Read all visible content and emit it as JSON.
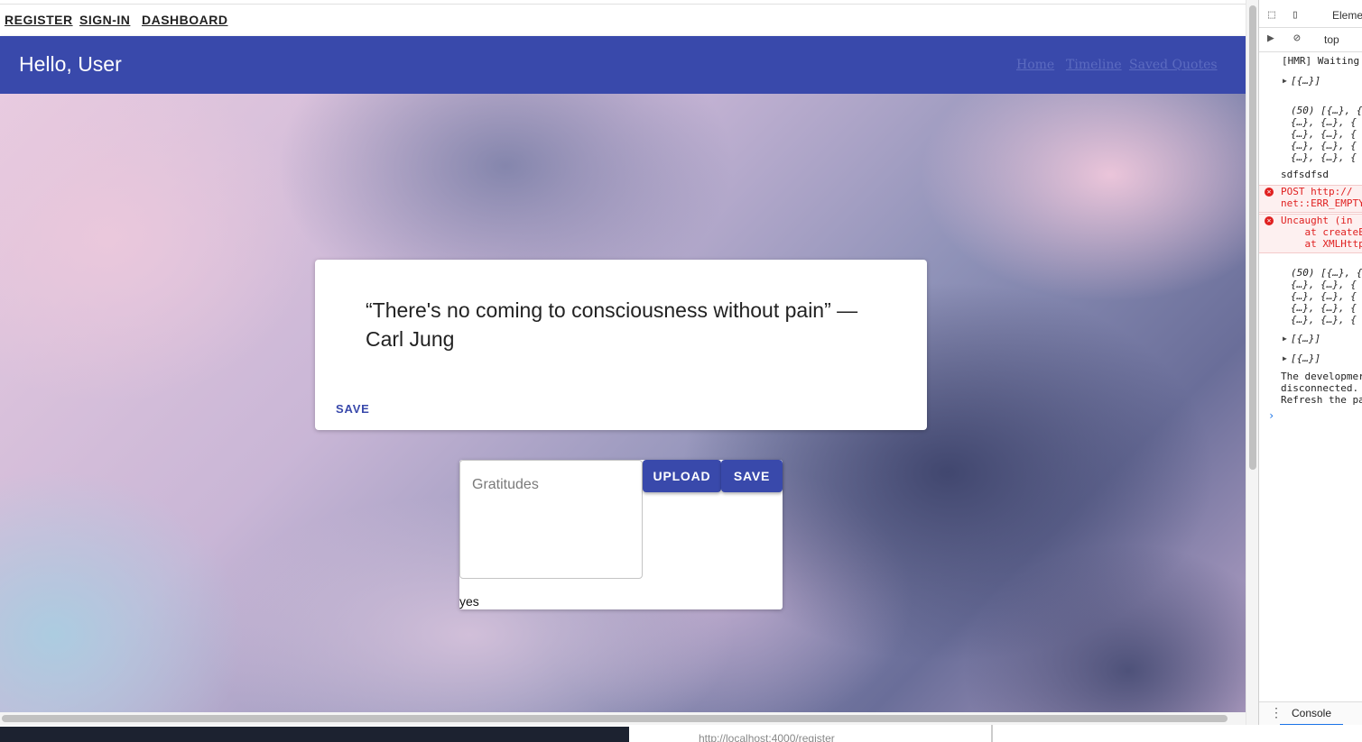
{
  "topnav": {
    "register": "REGISTER",
    "signin": "SIGN-IN",
    "dashboard": "DASHBOARD"
  },
  "appbar": {
    "title": "Hello, User",
    "links": [
      "Home",
      "Timeline",
      "Saved Quotes"
    ]
  },
  "quote_card": {
    "quote": "“There's no coming to consciousness without pain” — Carl Jung",
    "save_label": "SAVE"
  },
  "gratitude": {
    "placeholder": "Gratitudes",
    "upload_label": "UPLOAD",
    "save_label": "SAVE",
    "entry": "yes"
  },
  "bottom": {
    "url": "http://localhost:4000/register"
  },
  "devtools": {
    "tab_elements": "Eleme",
    "context": "top",
    "logs": {
      "l1": "[HMR] Waiting",
      "l2": "[{…}]",
      "l3": "(50) [{…}, {\n{…}, {…}, {\n{…}, {…}, {\n{…}, {…}, {\n{…}, {…}, {",
      "l4": "sdfsdfsd",
      "e1": "POST http://\nnet::ERR_EMPTY",
      "e2": "Uncaught (in\n    at createE\n    at XMLHttp",
      "l5": "(50) [{…}, {\n{…}, {…}, {\n{…}, {…}, {\n{…}, {…}, {\n{…}, {…}, {",
      "l6": "[{…}]",
      "l7": "[{…}]",
      "l8": "The developmer\ndisconnected.\nRefresh the pa"
    },
    "drawer_tab": "Console"
  }
}
